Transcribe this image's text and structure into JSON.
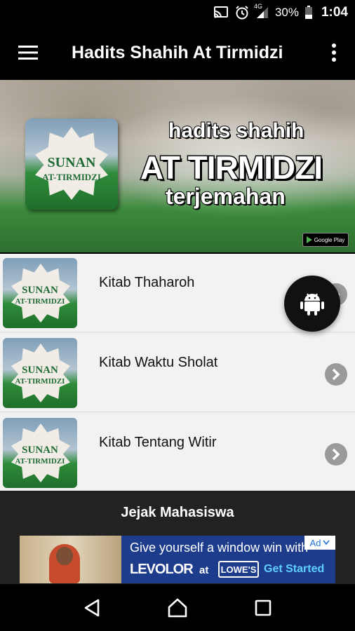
{
  "status_bar": {
    "network_label": "4G",
    "battery": "30%",
    "time": "1:04",
    "icons": [
      "cast-icon",
      "alarm-icon",
      "signal-icon",
      "battery-icon"
    ]
  },
  "toolbar": {
    "title": "Hadits Shahih At Tirmidzi",
    "menu_icon": "hamburger-menu-icon",
    "more_icon": "more-vert-icon"
  },
  "banner": {
    "line1": "hadits shahih",
    "line2": "AT TIRMIDZI",
    "line3": "terjemahan",
    "book_title1": "SUNAN",
    "book_title2": "AT-TIRMIDZI",
    "store_badge": "Google Play"
  },
  "list": {
    "items": [
      {
        "label": "Kitab Thaharoh",
        "thumb1": "SUNAN",
        "thumb2": "AT-TIRMIDZI"
      },
      {
        "label": "Kitab Waktu Sholat",
        "thumb1": "SUNAN",
        "thumb2": "AT-TIRMIDZI"
      },
      {
        "label": "Kitab Tentang Witir",
        "thumb1": "SUNAN",
        "thumb2": "AT-TIRMIDZI"
      }
    ]
  },
  "fab": {
    "icon": "android-icon"
  },
  "footer": {
    "name": "Jejak Mahasiswa"
  },
  "ad": {
    "headline": "Give yourself a window win with",
    "brand": "LEVOLOR",
    "at": "at",
    "store": "LOWE'S",
    "cta": "Get Started",
    "badge": "Ad"
  },
  "nav": {
    "back_icon": "back-icon",
    "home_icon": "home-icon",
    "recents_icon": "recents-icon"
  },
  "colors": {
    "bar": "#000000",
    "list_bg": "#f2f2f2",
    "footer": "#222222",
    "ad_bg": "#1d3c8c",
    "chevron": "#9a9a9a"
  }
}
